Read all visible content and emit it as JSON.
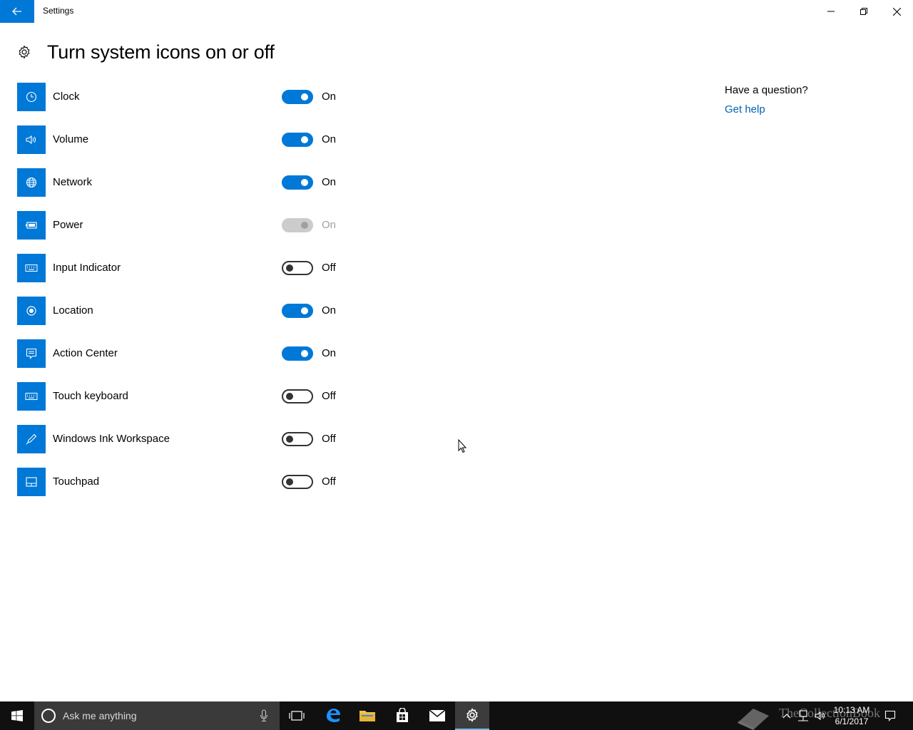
{
  "window": {
    "title": "Settings"
  },
  "page": {
    "title": "Turn system icons on or off"
  },
  "settings": [
    {
      "label": "Clock",
      "icon": "clock-icon",
      "state": "On",
      "mode": "on"
    },
    {
      "label": "Volume",
      "icon": "volume-icon",
      "state": "On",
      "mode": "on"
    },
    {
      "label": "Network",
      "icon": "network-icon",
      "state": "On",
      "mode": "on"
    },
    {
      "label": "Power",
      "icon": "battery-icon",
      "state": "On",
      "mode": "disabled"
    },
    {
      "label": "Input Indicator",
      "icon": "keyboard-icon",
      "state": "Off",
      "mode": "off"
    },
    {
      "label": "Location",
      "icon": "location-icon",
      "state": "On",
      "mode": "on"
    },
    {
      "label": "Action Center",
      "icon": "action-center-icon",
      "state": "On",
      "mode": "on"
    },
    {
      "label": "Touch keyboard",
      "icon": "keyboard-icon",
      "state": "Off",
      "mode": "off"
    },
    {
      "label": "Windows Ink Workspace",
      "icon": "pen-icon",
      "state": "Off",
      "mode": "off"
    },
    {
      "label": "Touchpad",
      "icon": "touchpad-icon",
      "state": "Off",
      "mode": "off"
    }
  ],
  "help": {
    "question": "Have a question?",
    "link": "Get help"
  },
  "taskbar": {
    "search_placeholder": "Ask me anything",
    "time": "10:13 AM",
    "date": "6/1/2017",
    "watermark": "TheCollectionBook"
  },
  "colors": {
    "accent": "#0078d7",
    "link": "#0063b1",
    "taskbar": "#101010"
  }
}
